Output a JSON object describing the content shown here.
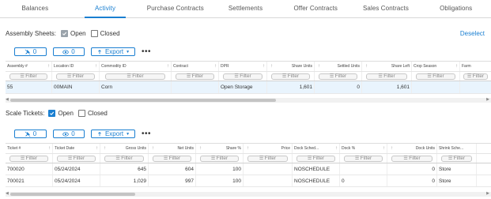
{
  "tabs": [
    "Balances",
    "Activity",
    "Purchase Contracts",
    "Settlements",
    "Offer Contracts",
    "Sales Contracts",
    "Obligations"
  ],
  "active_tab": "Activity",
  "assembly": {
    "label": "Assembly Sheets:",
    "open_label": "Open",
    "closed_label": "Closed",
    "open_checked": true,
    "closed_checked": false,
    "deselect_label": "Deselect",
    "toolbar": {
      "pin_count": "0",
      "eye_count": "0",
      "export_label": "Export",
      "more_label": "•••"
    },
    "columns": [
      "Assembly #",
      "Location ID",
      "Commodity ID",
      "Contract",
      "DPR",
      "Share Units",
      "Settled Units",
      "Share Left",
      "Crop Season",
      "Farm"
    ],
    "filter_label": "Filter",
    "rows": [
      [
        "55",
        "00MAIN",
        "Corn",
        "",
        "Open Storage",
        "1,601",
        "0",
        "1,601",
        "",
        ""
      ]
    ]
  },
  "scale": {
    "label": "Scale Tickets:",
    "open_label": "Open",
    "closed_label": "Closed",
    "open_checked": true,
    "closed_checked": false,
    "toolbar": {
      "pin_count": "0",
      "eye_count": "0",
      "export_label": "Export",
      "more_label": "•••"
    },
    "columns": [
      "Ticket #",
      "Ticket Date",
      "Gross Units",
      "Net Units",
      "Share %",
      "Price",
      "Dock Sched...",
      "Dock %",
      "Dock Units",
      "Shrink Sche..."
    ],
    "filter_label": "Filter",
    "rows": [
      [
        "700020",
        "05/24/2024",
        "645",
        "604",
        "100",
        "",
        "NOSCHEDULE",
        "",
        "0",
        "Store"
      ],
      [
        "700021",
        "05/24/2024",
        "1,029",
        "997",
        "100",
        "",
        "NOSCHEDULE",
        "0",
        "0",
        "Store"
      ]
    ]
  },
  "colors": {
    "accent": "#1a7fd1",
    "selected_row": "#e9f4fd"
  }
}
